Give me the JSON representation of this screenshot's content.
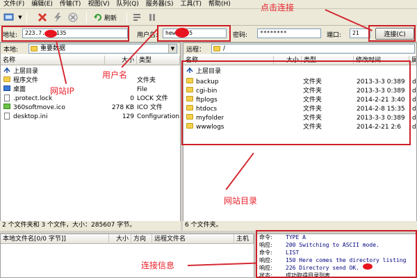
{
  "menu": [
    "文件(F)",
    "编辑(E)",
    "传输(T)",
    "视图(V)",
    "队列(Q)",
    "服务器(S)",
    "工具(T)",
    "帮助(H)"
  ],
  "toolbar": {
    "refresh_label": "刷新"
  },
  "connection": {
    "address_label": "地址:",
    "address_value": "223.7.",
    "address_value_tail": "135",
    "username_label": "用户名:",
    "username_value": "hew",
    "username_value_tail": "35",
    "password_label": "密码:",
    "password_value": "********",
    "port_label": "端口:",
    "port_value": "21",
    "connect_label": "连接(C)"
  },
  "local": {
    "label": "本地:",
    "path": "重要数据",
    "headers": [
      "名称",
      "大小",
      "类型"
    ],
    "rows": [
      {
        "name": "上层目录",
        "size": "",
        "type": ""
      },
      {
        "name": "程序文件",
        "size": "",
        "type": "文件夹"
      },
      {
        "name": "桌面",
        "size": "",
        "type": "File"
      },
      {
        "name": ".protect.lock",
        "size": "0",
        "type": "LOCK 文件"
      },
      {
        "name": "360softmove.ico",
        "size": "278 KB",
        "type": "ICO 文件"
      },
      {
        "name": "desktop.ini",
        "size": "129",
        "type": "Configuration"
      }
    ],
    "status": "2 个文件夹和 3 个文件，大小：285607 字节。"
  },
  "remote": {
    "label": "远程：",
    "path": "/",
    "headers": [
      "名称",
      "大小",
      "类型",
      "修改时间",
      "属性"
    ],
    "rows": [
      {
        "name": "上层目录",
        "type": "",
        "time": "",
        "attr": ""
      },
      {
        "name": "backup",
        "type": "文件夹",
        "time": "2013-3-3 0:389",
        "attr": "d"
      },
      {
        "name": "cgi-bin",
        "type": "文件夹",
        "time": "2013-3-3 0:389",
        "attr": "d"
      },
      {
        "name": "ftplogs",
        "type": "文件夹",
        "time": "2014-2-21 3:40",
        "attr": "d"
      },
      {
        "name": "htdocs",
        "type": "文件夹",
        "time": "2014-2-8 15:35",
        "attr": "d"
      },
      {
        "name": "myfolder",
        "type": "文件夹",
        "time": "2013-3-3 0:389",
        "attr": "d"
      },
      {
        "name": "wwwlogs",
        "type": "文件夹",
        "time": "2014-2-21 2:6",
        "attr": "d"
      }
    ],
    "status": "6 个文件夹。"
  },
  "queue": {
    "headers": [
      "本地文件名[0/0 字节]]",
      "大小",
      "方向",
      "远程文件名",
      "主机"
    ]
  },
  "log": [
    {
      "label": "命令:",
      "text": "TYPE A"
    },
    {
      "label": "响应:",
      "text": "200 Switching to ASCII mode."
    },
    {
      "label": "命令:",
      "text": "LIST"
    },
    {
      "label": "响应:",
      "text": "150 Here comes the directory listing"
    },
    {
      "label": "响应:",
      "text": "226 Directory send OK."
    },
    {
      "label": "状态:",
      "text": "成功取得目录列表"
    }
  ],
  "annotations": {
    "click_connect": "点击连接",
    "username": "用户名",
    "site_ip": "网站IP",
    "site_dir": "网站目录",
    "conn_info": "连接信息"
  },
  "colors": {
    "annotation": "#e8212b",
    "chrome": "#ece9d8",
    "selection": "#316ac5"
  }
}
